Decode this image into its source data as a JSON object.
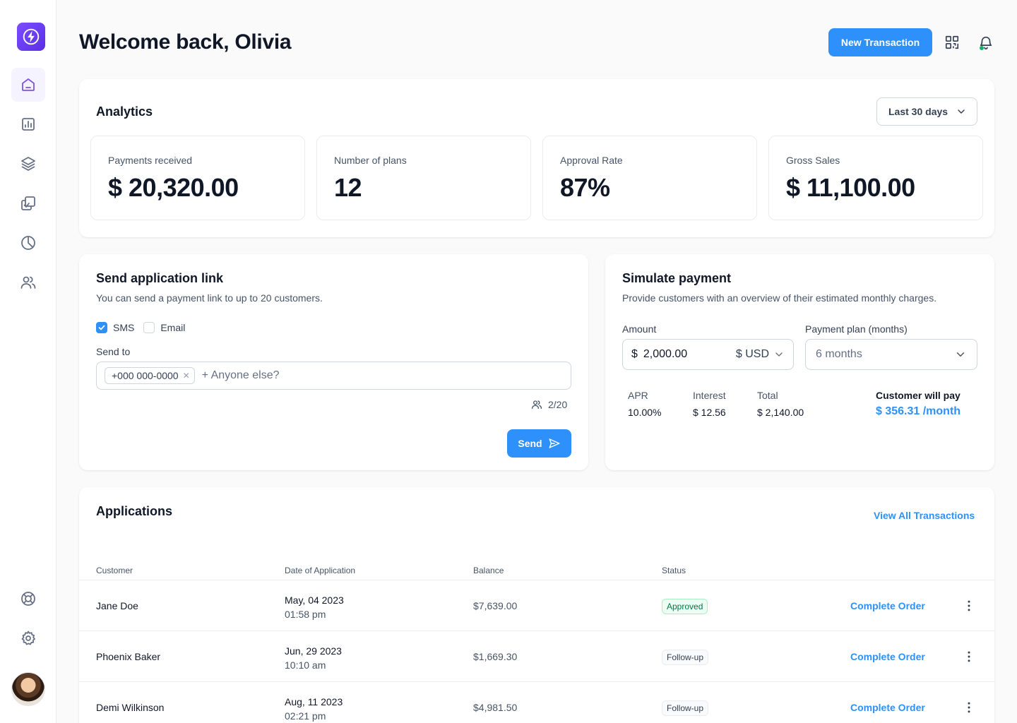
{
  "header": {
    "title": "Welcome back, Olivia",
    "new_transaction": "New Transaction",
    "qr_icon": "qr-code-icon",
    "bell_icon": "bell-icon"
  },
  "sidebar": {
    "items": [
      {
        "name": "home",
        "icon": "home-icon",
        "active": true
      },
      {
        "name": "reports",
        "icon": "bar-chart-icon"
      },
      {
        "name": "layers",
        "icon": "layers-icon"
      },
      {
        "name": "tasks",
        "icon": "check-copy-icon"
      },
      {
        "name": "analytics",
        "icon": "pie-chart-icon"
      },
      {
        "name": "users",
        "icon": "users-icon"
      }
    ],
    "bottom": [
      {
        "name": "support",
        "icon": "life-buoy-icon"
      },
      {
        "name": "settings",
        "icon": "gear-icon"
      }
    ]
  },
  "analytics": {
    "title": "Analytics",
    "range": "Last 30 days",
    "stats": [
      {
        "label": "Payments received",
        "value": "$ 20,320.00"
      },
      {
        "label": "Number of plans",
        "value": "12"
      },
      {
        "label": "Approval Rate",
        "value": "87%"
      },
      {
        "label": "Gross Sales",
        "value": "$ 11,100.00"
      }
    ]
  },
  "send_link": {
    "title": "Send application link",
    "subtitle": "You can send a payment link to up to 20 customers.",
    "sms_label": "SMS",
    "email_label": "Email",
    "sms_checked": true,
    "email_checked": false,
    "send_to_label": "Send to",
    "chip": "+000 000-0000",
    "placeholder": "+ Anyone else?",
    "counter": "2/20",
    "send_label": "Send"
  },
  "simulate": {
    "title": "Simulate payment",
    "subtitle": "Provide customers with an overview of their estimated monthly charges.",
    "amount_label": "Amount",
    "currency_symbol": "$",
    "amount_value": "2,000.00",
    "currency": "$ USD",
    "plan_label": "Payment plan (months)",
    "plan_value": "6 months",
    "apr_label": "APR",
    "apr_value": "10.00%",
    "interest_label": "Interest",
    "interest_value": "$ 12.56",
    "total_label": "Total",
    "total_value": "$ 2,140.00",
    "pay_label": "Customer will pay",
    "pay_value": "$ 356.31 /month"
  },
  "applications": {
    "title": "Applications",
    "view_all": "View All Transactions",
    "columns": [
      "Customer",
      "Date of Application",
      "Balance",
      "Status"
    ],
    "action_label": "Complete Order",
    "rows": [
      {
        "customer": "Jane Doe",
        "date": "May, 04 2023",
        "time": "01:58 pm",
        "balance": "$7,639.00",
        "status": "Approved"
      },
      {
        "customer": "Phoenix Baker",
        "date": "Jun, 29 2023",
        "time": "10:10 am",
        "balance": "$1,669.30",
        "status": "Follow-up"
      },
      {
        "customer": "Demi Wilkinson",
        "date": "Aug, 11 2023",
        "time": "02:21 pm",
        "balance": "$4,981.50",
        "status": "Follow-up"
      }
    ]
  },
  "colors": {
    "accent": "#2e90fa",
    "brand": "#6c3cf0",
    "approved": "#067647"
  }
}
